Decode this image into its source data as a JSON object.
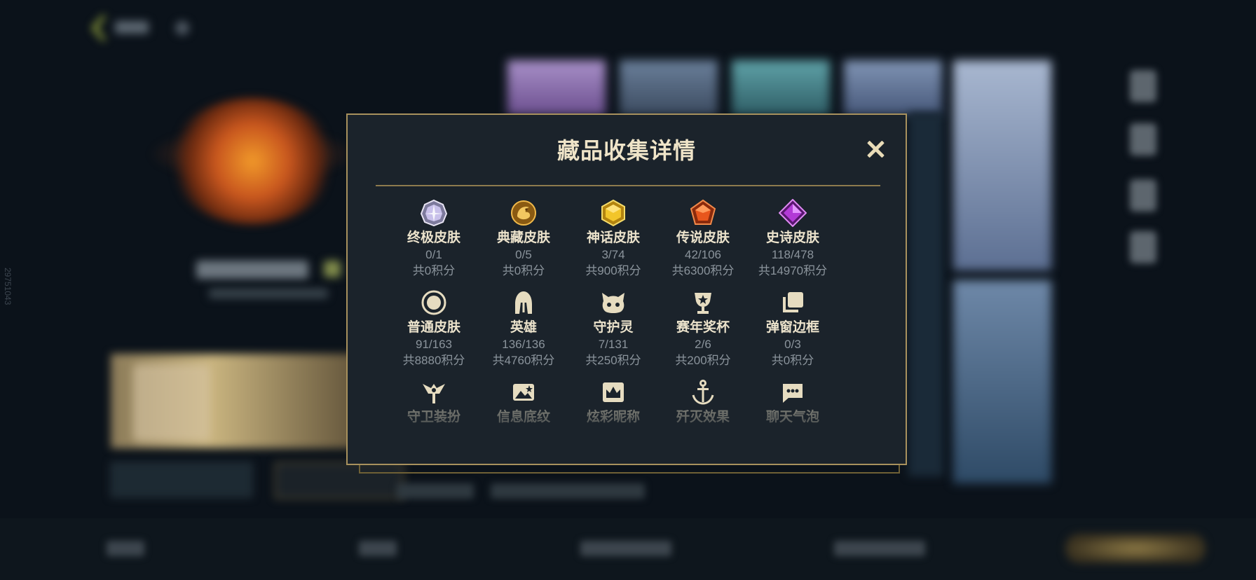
{
  "modal": {
    "title": "藏品收集详情",
    "close_label": "×"
  },
  "items": [
    {
      "label": "终极皮肤",
      "count": "0/1",
      "points": "共0积分",
      "icon": "ultimate-skin-icon"
    },
    {
      "label": "典藏皮肤",
      "count": "0/5",
      "points": "共0积分",
      "icon": "collector-skin-icon"
    },
    {
      "label": "神话皮肤",
      "count": "3/74",
      "points": "共900积分",
      "icon": "mythic-skin-icon"
    },
    {
      "label": "传说皮肤",
      "count": "42/106",
      "points": "共6300积分",
      "icon": "legendary-skin-icon"
    },
    {
      "label": "史诗皮肤",
      "count": "118/478",
      "points": "共14970积分",
      "icon": "epic-skin-icon"
    },
    {
      "label": "普通皮肤",
      "count": "91/163",
      "points": "共8880积分",
      "icon": "normal-skin-icon"
    },
    {
      "label": "英雄",
      "count": "136/136",
      "points": "共4760积分",
      "icon": "champion-helmet-icon"
    },
    {
      "label": "守护灵",
      "count": "7/131",
      "points": "共250积分",
      "icon": "guardian-spirit-icon"
    },
    {
      "label": "赛年奖杯",
      "count": "2/6",
      "points": "共200积分",
      "icon": "season-trophy-icon"
    },
    {
      "label": "弹窗边框",
      "count": "0/3",
      "points": "共0积分",
      "icon": "popup-frame-icon"
    },
    {
      "label": "守卫装扮",
      "icon": "ward-skin-icon"
    },
    {
      "label": "信息底纹",
      "icon": "info-banner-icon"
    },
    {
      "label": "炫彩昵称",
      "icon": "color-nickname-icon"
    },
    {
      "label": "歼灭效果",
      "icon": "elimination-effect-icon"
    },
    {
      "label": "聊天气泡",
      "icon": "chat-bubble-icon"
    }
  ],
  "colors": {
    "gold_border": "#a8915d",
    "modal_bg": "#1b232b",
    "title": "#efe4c8",
    "muted": "#8b949c"
  },
  "background": {
    "side_id": "29751043"
  }
}
